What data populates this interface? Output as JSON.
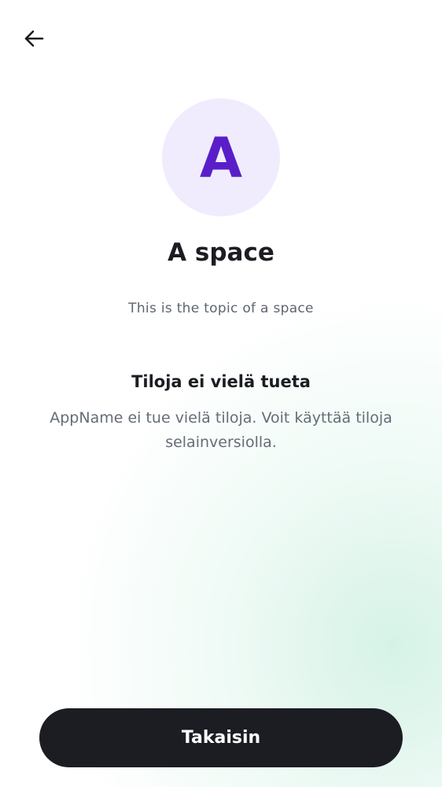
{
  "toolbar": {
    "back_icon": "arrow-left-icon"
  },
  "space": {
    "avatar_letter": "A",
    "name": "A space",
    "topic": "This is the topic of a space"
  },
  "notice": {
    "title": "Tiloja ei vielä tueta",
    "body": "AppName ei tue vielä tiloja. Voit käyttää tiloja selainversiolla."
  },
  "actions": {
    "back_label": "Takaisin"
  },
  "colors": {
    "avatar_background": "#f0ecfe",
    "avatar_letter": "#5a1ec9",
    "button_background": "#1b1d22",
    "button_text": "#ffffff",
    "text_primary": "#1b1d22",
    "text_secondary": "#656c76",
    "gradient_accent": "#dff5ec"
  }
}
